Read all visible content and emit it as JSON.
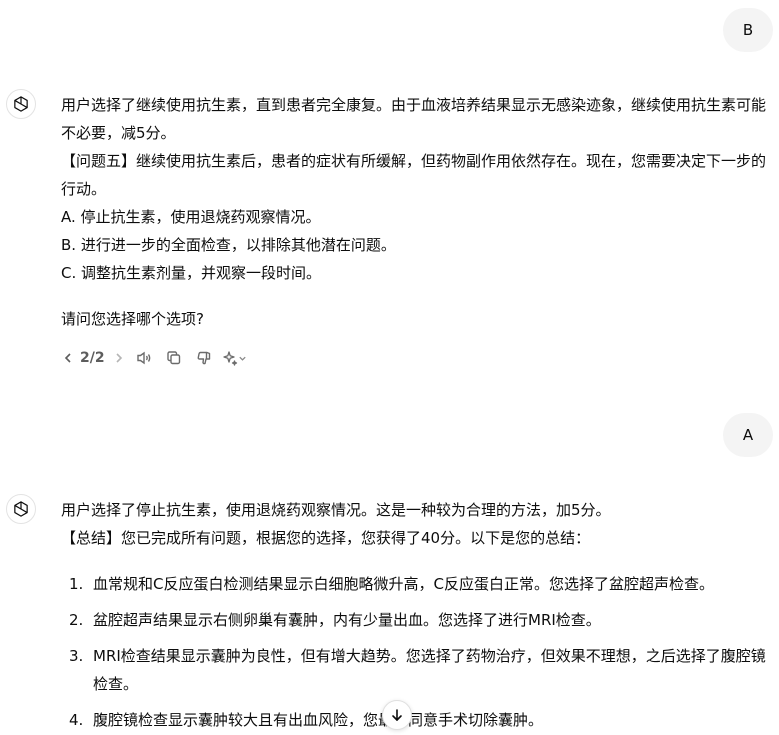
{
  "conversation": {
    "user_msg_1": "B",
    "assistant_1": {
      "lines": [
        "用户选择了继续使用抗生素，直到患者完全康复。由于血液培养结果显示无感染迹象，继续使用抗生素可能不必要，减5分。",
        "【问题五】继续使用抗生素后，患者的症状有所缓解，但药物副作用依然存在。现在，您需要决定下一步的行动。",
        "A. 停止抗生素，使用退烧药观察情况。",
        "B. 进行进一步的全面检查，以排除其他潜在问题。",
        "C. 调整抗生素剂量，并观察一段时间。"
      ],
      "question": "请问您选择哪个选项?",
      "pager": "2/2"
    },
    "user_msg_2": "A",
    "assistant_2": {
      "lines": [
        "用户选择了停止抗生素，使用退烧药观察情况。这是一种较为合理的方法，加5分。",
        "【总结】您已完成所有问题，根据您的选择，您获得了40分。以下是您的总结："
      ],
      "summary": [
        {
          "num": "1.",
          "text": "血常规和C反应蛋白检测结果显示白细胞略微升高，C反应蛋白正常。您选择了盆腔超声检查。"
        },
        {
          "num": "2.",
          "text": "盆腔超声结果显示右侧卵巢有囊肿，内有少量出血。您选择了进行MRI检查。"
        },
        {
          "num": "3.",
          "text": "MRI检查结果显示囊肿为良性，但有增大趋势。您选择了药物治疗，但效果不理想，之后选择了腹腔镜检查。"
        },
        {
          "num": "4.",
          "text": "腹腔镜检查显示囊肿较大且有出血风险，您最终同意手术切除囊肿。"
        }
      ]
    }
  },
  "icons": {
    "assistant_avatar": "openai-logo-icon",
    "prev": "chevron-left-icon",
    "next": "chevron-right-icon",
    "read_aloud": "speaker-icon",
    "copy": "copy-icon",
    "dislike": "thumbs-down-icon",
    "regenerate": "sparkle-icon",
    "scroll": "arrow-down-icon"
  }
}
